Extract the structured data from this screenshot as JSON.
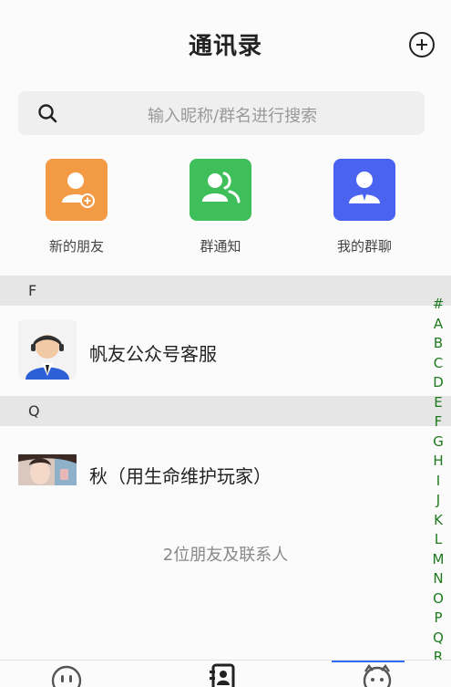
{
  "header": {
    "title": "通讯录"
  },
  "search": {
    "placeholder": "输入昵称/群名进行搜索"
  },
  "quick_actions": [
    {
      "label": "新的朋友",
      "color": "#f29a44",
      "icon": "add-user-icon"
    },
    {
      "label": "群通知",
      "color": "#3fbf5a",
      "icon": "group-icon"
    },
    {
      "label": "我的群聊",
      "color": "#4a63f0",
      "icon": "person-tie-icon"
    }
  ],
  "sections": [
    {
      "letter": "F",
      "contacts": [
        {
          "name": "帆友公众号客服",
          "avatar": "customer-service-avatar"
        }
      ]
    },
    {
      "letter": "Q",
      "contacts": [
        {
          "name": "秋（用生命维护玩家）",
          "avatar": "photo-avatar"
        }
      ]
    }
  ],
  "footer": {
    "count_text": "2位朋友及联系人"
  },
  "index_letters": [
    "#",
    "A",
    "B",
    "C",
    "D",
    "E",
    "F",
    "G",
    "H",
    "I",
    "J",
    "K",
    "L",
    "M",
    "N",
    "O",
    "P",
    "Q",
    "R"
  ],
  "tabbar": {
    "tabs": [
      "chat-tab",
      "contacts-tab",
      "discover-tab"
    ],
    "active": "contacts-tab"
  }
}
